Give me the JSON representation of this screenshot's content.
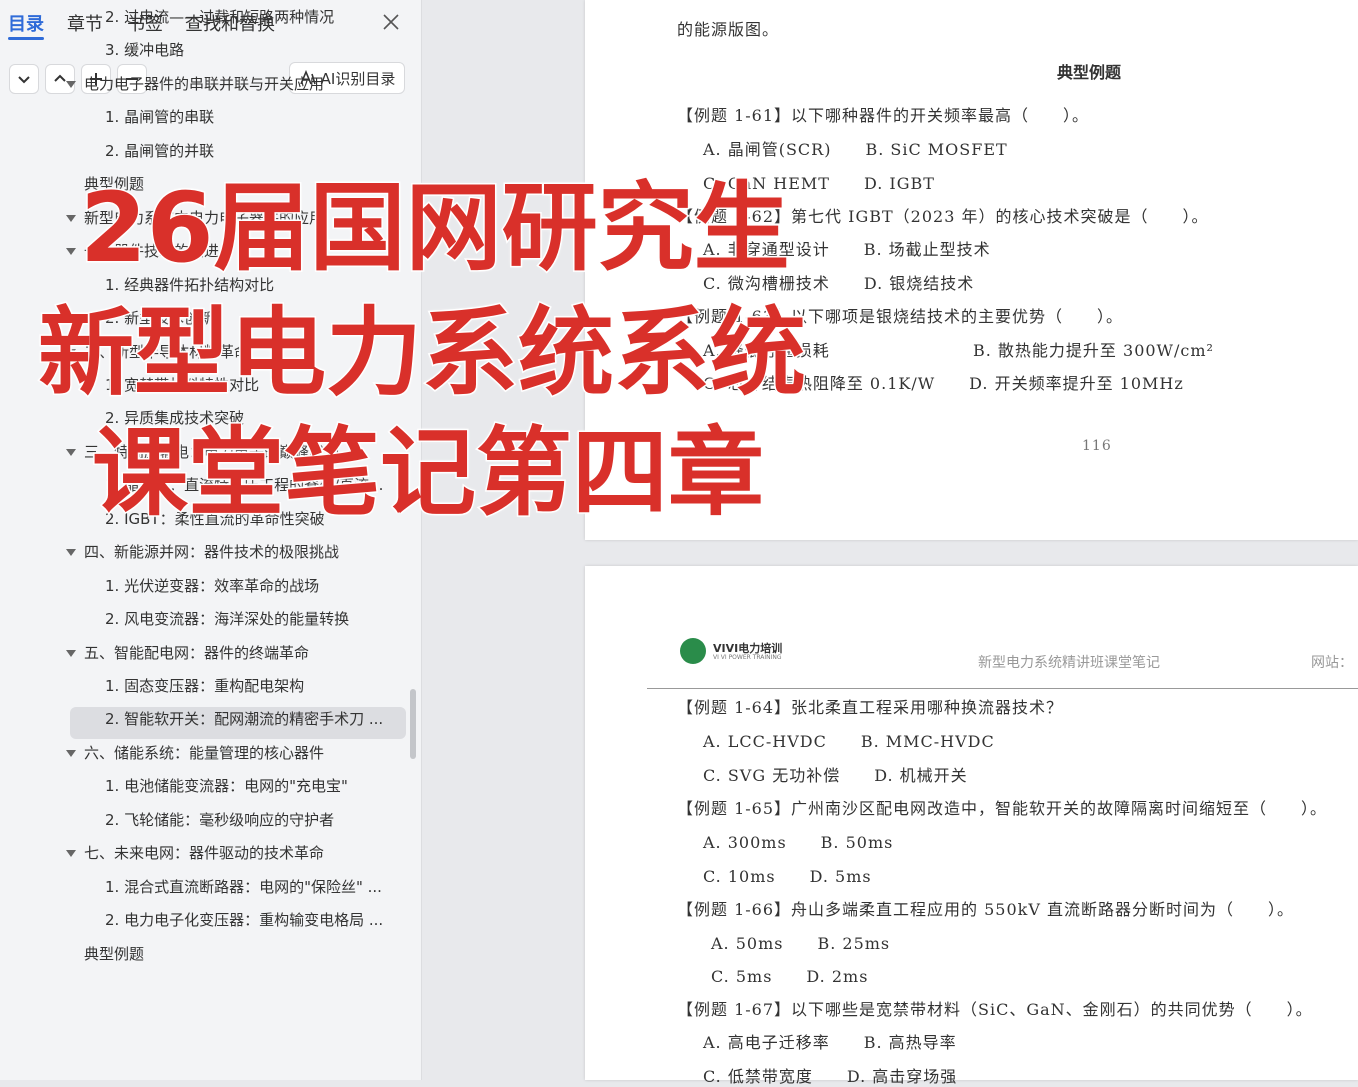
{
  "sidebar": {
    "tabs": [
      "目录",
      "章节",
      "书签",
      "查找和替换"
    ],
    "ai_button_label": "AI识别目录",
    "toc": [
      {
        "label": "2. 过电流——过载和短路两种情况"
      },
      {
        "label": "3. 缓冲电路"
      },
      {
        "label": "电力电子器件的串联并联与开关应用"
      },
      {
        "label": "1. 晶闸管的串联"
      },
      {
        "label": "2. 晶闸管的并联"
      },
      {
        "label": "典型例题"
      },
      {
        "label": "新型电力系统中电力电子器件的应用"
      },
      {
        "label": "一、器件技术的演进"
      },
      {
        "label": "1. 经典器件拓扑结构对比"
      },
      {
        "label": "2. 新型技术创新"
      },
      {
        "label": "二、新型半导体材料革命"
      },
      {
        "label": "1. 宽禁带材料特性对比"
      },
      {
        "label": "2. 异质集成技术突破"
      },
      {
        "label": "三、特高压输电：电力电子的巅峰战场"
      },
      {
        "label": "1. 晶闸管：直流特高压工程的脊梁/直流..."
      },
      {
        "label": "2. IGBT：柔性直流的革命性突破"
      },
      {
        "label": "四、新能源并网：器件技术的极限挑战"
      },
      {
        "label": "1. 光伏逆变器：效率革命的战场"
      },
      {
        "label": "2. 风电变流器：海洋深处的能量转换"
      },
      {
        "label": "五、智能配电网：器件的终端革命"
      },
      {
        "label": "1. 固态变压器：重构配电架构"
      },
      {
        "label": "2. 智能软开关：配网潮流的精密手术刀 ..."
      },
      {
        "label": "六、储能系统：能量管理的核心器件"
      },
      {
        "label": "1. 电池储能变流器：电网的\"充电宝\""
      },
      {
        "label": "2. 飞轮储能：毫秒级响应的守护者"
      },
      {
        "label": "七、未来电网：器件驱动的技术革命"
      },
      {
        "label": "1. 混合式直流断路器：电网的\"保险丝\" ..."
      },
      {
        "label": "2. 电力电子化变压器：重构输变电格局 ..."
      },
      {
        "label": "典型例题"
      }
    ]
  },
  "page1": {
    "top_text": "的能源版图。",
    "section_title": "典型例题",
    "lines": [
      "【例题 1-61】以下哪种器件的开关频率最高（　　）。",
      "A. 晶闸管(SCR)　　B. SiC MOSFET",
      "C. GaN HEMT　　D. IGBT",
      "【例题 1-62】第七代 IGBT（2023 年）的核心技术突破是（　　）。",
      "A. 非穿通型设计　　B. 场截止型技术",
      "C. 微沟槽栅技术　　D. 银烧结技术",
      "【例题 1-63】以下哪项是银烧结技术的主要优势（　　）。",
      "A. 降低导通损耗",
      "B. 散热能力提升至 300W/cm²",
      "C. 芯片结壳热阻降至 0.1K/W　　D. 开关频率提升至 10MHz"
    ],
    "page_number": "116"
  },
  "page2": {
    "logo_text": "VIVI电力培训",
    "logo_subtext": "VI VI POWER TRAINING",
    "header_title": "新型电力系统精讲班课堂笔记",
    "header_right": "网站：",
    "lines": [
      "【例题 1-64】张北柔直工程采用哪种换流器技术？",
      "A. LCC-HVDC　　B. MMC-HVDC",
      "C. SVG 无功补偿　　D. 机械开关",
      "【例题 1-65】广州南沙区配电网改造中，智能软开关的故障隔离时间缩短至（　　）。",
      "A. 300ms　　B. 50ms",
      "C. 10ms　　D. 5ms",
      "【例题 1-66】舟山多端柔直工程应用的 550kV 直流断路器分断时间为（　　）。",
      "A. 50ms　　B. 25ms",
      "C. 5ms　　D. 2ms",
      "【例题 1-67】以下哪些是宽禁带材料（SiC、GaN、金刚石）的共同优势（　　）。",
      "A. 高电子迁移率　　B. 高热导率",
      "C. 低禁带宽度　　D. 高击穿场强"
    ]
  },
  "overlay": {
    "line1": "26届国网研究生",
    "line2": "新型电力系统系统",
    "line3": "课堂笔记第四章"
  },
  "colors": {
    "accent": "#2f6bd8",
    "overlay_red": "#d9302a"
  }
}
